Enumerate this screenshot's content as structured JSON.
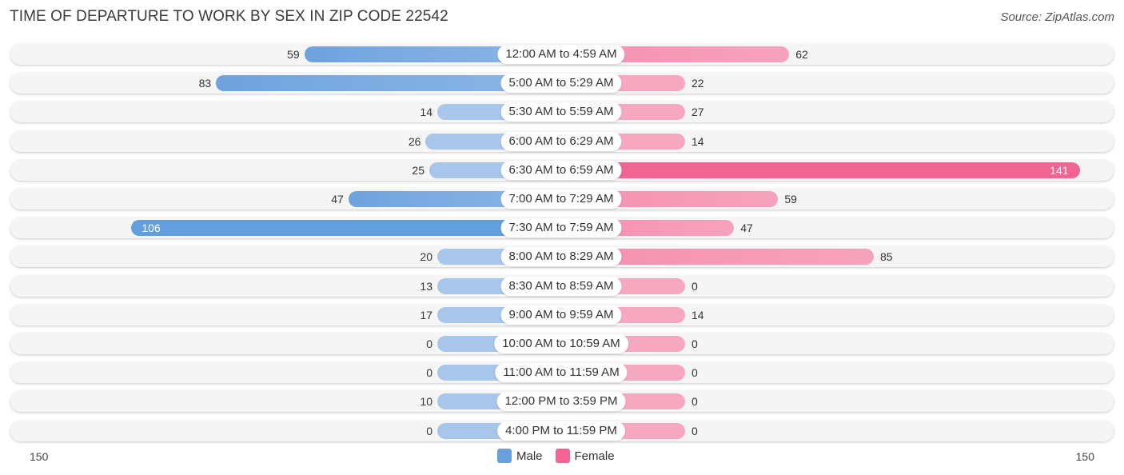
{
  "header": {
    "title": "TIME OF DEPARTURE TO WORK BY SEX IN ZIP CODE 22542",
    "source": "Source: ZipAtlas.com"
  },
  "colors": {
    "male": "#6a9fdc",
    "female": "#f06591",
    "row_background": "#f5f5f5"
  },
  "chart_data": {
    "type": "bar",
    "orientation": "horizontal-diverging",
    "title": "TIME OF DEPARTURE TO WORK BY SEX IN ZIP CODE 22542",
    "categories": [
      "12:00 AM to 4:59 AM",
      "5:00 AM to 5:29 AM",
      "5:30 AM to 5:59 AM",
      "6:00 AM to 6:29 AM",
      "6:30 AM to 6:59 AM",
      "7:00 AM to 7:29 AM",
      "7:30 AM to 7:59 AM",
      "8:00 AM to 8:29 AM",
      "8:30 AM to 8:59 AM",
      "9:00 AM to 9:59 AM",
      "10:00 AM to 10:59 AM",
      "11:00 AM to 11:59 AM",
      "12:00 PM to 3:59 PM",
      "4:00 PM to 11:59 PM"
    ],
    "series": [
      {
        "name": "Male",
        "values": [
          59,
          83,
          14,
          26,
          25,
          47,
          106,
          20,
          13,
          17,
          0,
          0,
          10,
          0
        ]
      },
      {
        "name": "Female",
        "values": [
          62,
          22,
          27,
          14,
          141,
          59,
          47,
          85,
          0,
          14,
          0,
          0,
          0,
          0
        ]
      }
    ],
    "axis": {
      "left_max_label": "150",
      "right_max_label": "150",
      "range": [
        -150,
        150
      ]
    },
    "legend": {
      "position": "bottom-center",
      "entries": [
        "Male",
        "Female"
      ]
    },
    "grid": false
  }
}
